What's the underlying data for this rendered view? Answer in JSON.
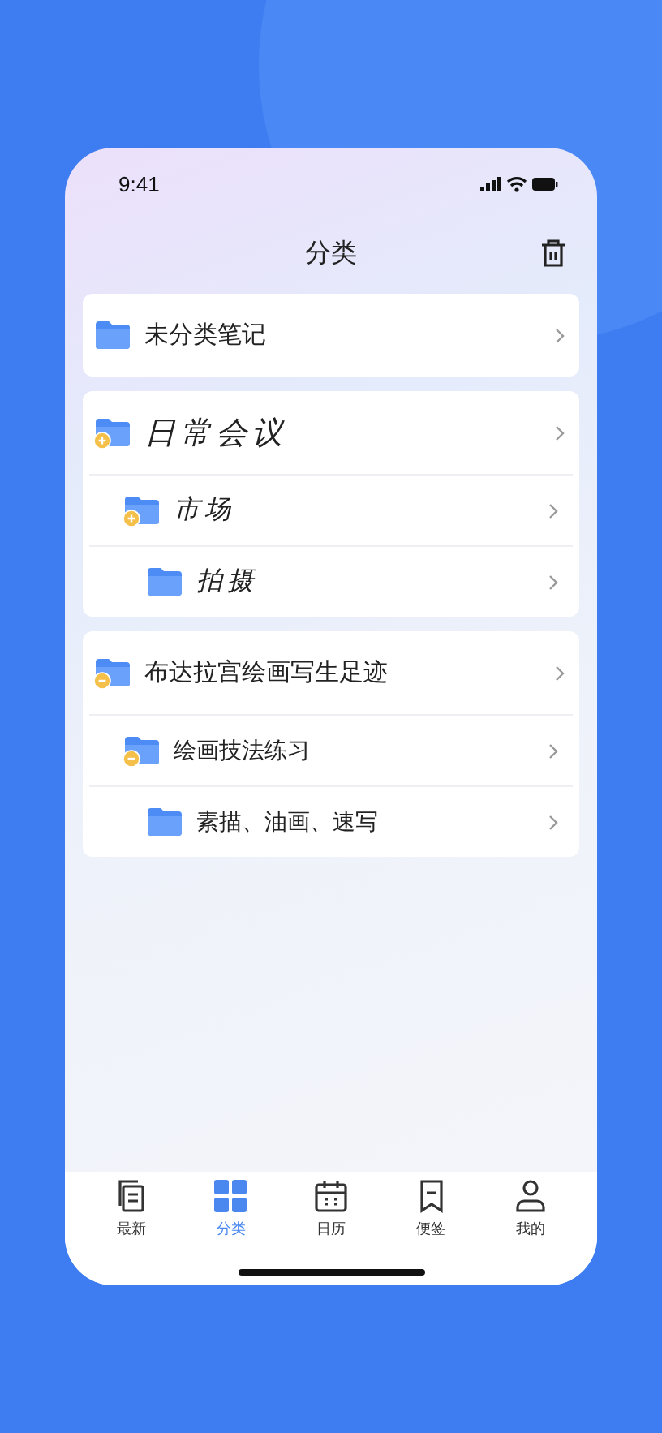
{
  "status_bar": {
    "time": "9:41"
  },
  "header": {
    "title": "分类"
  },
  "folders": [
    {
      "name": "未分类笔记",
      "kind": "typed"
    },
    {
      "name": "日常会议",
      "kind": "handwritten",
      "expanded": false,
      "children": [
        {
          "name": "市场",
          "kind": "handwritten",
          "expanded": false,
          "children": [
            {
              "name": "拍摄",
              "kind": "handwritten"
            }
          ]
        }
      ]
    },
    {
      "name": "布达拉宫绘画写生足迹",
      "kind": "typed",
      "expanded": true,
      "children": [
        {
          "name": "绘画技法练习",
          "kind": "typed",
          "expanded": true,
          "children": [
            {
              "name": "素描、油画、速写",
              "kind": "typed"
            }
          ]
        }
      ]
    }
  ],
  "tab_bar": [
    {
      "label": "最新",
      "selected": false
    },
    {
      "label": "分类",
      "selected": true
    },
    {
      "label": "日历",
      "selected": false
    },
    {
      "label": "便签",
      "selected": false
    },
    {
      "label": "我的",
      "selected": false
    }
  ]
}
